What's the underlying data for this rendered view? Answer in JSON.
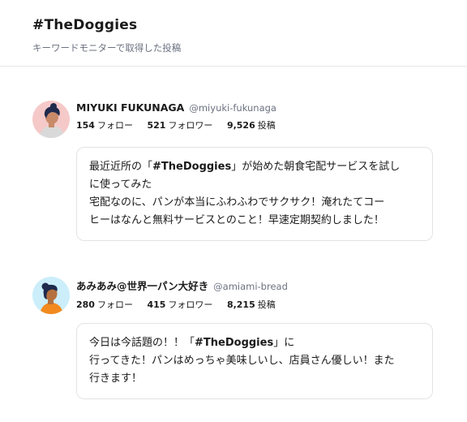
{
  "header": {
    "title": "#TheDoggies",
    "subtitle": "キーワードモニターで取得した投稿"
  },
  "posts": [
    {
      "name": "MIYUKI FUKUNAGA",
      "handle": "@miyuki-fukunaga",
      "follow_count": "154",
      "follow_label": "フォロー",
      "follower_count": "521",
      "follower_label": "フォロワー",
      "post_count": "9,526",
      "post_label": "投稿",
      "text_lines": [
        [
          "最近近所の「",
          "#TheDoggies",
          "」が始めた朝食宅配サービスを試し"
        ],
        [
          "に使ってみた"
        ],
        [
          "宅配なのに、パンが本当にふわふわでサクサク！淹れたてコー"
        ],
        [
          "ヒーはなんと無料サービスとのこと！早速定期契約しました！"
        ]
      ],
      "avatar_colors": {
        "bg": "#f6c9c9",
        "skin": "#c98a6a",
        "hair": "#1f2a4d",
        "shirt": "#d9d9d9"
      }
    },
    {
      "name": "あみあみ@世界一パン大好き",
      "handle": "@amiami-bread",
      "follow_count": "280",
      "follow_label": "フォロー",
      "follower_count": "415",
      "follower_label": "フォロワー",
      "post_count": "8,215",
      "post_label": "投稿",
      "text_lines": [
        [
          "今日は今話題の！！「",
          "#TheDoggies",
          "」に"
        ],
        [
          "行ってきた！パンはめっちゃ美味しいし、店員さん優しい！また"
        ],
        [
          "行きます！"
        ]
      ],
      "avatar_colors": {
        "bg": "#cbeefa",
        "skin": "#b5703f",
        "hair": "#1f2a4d",
        "shirt": "#f28a1d"
      }
    }
  ]
}
